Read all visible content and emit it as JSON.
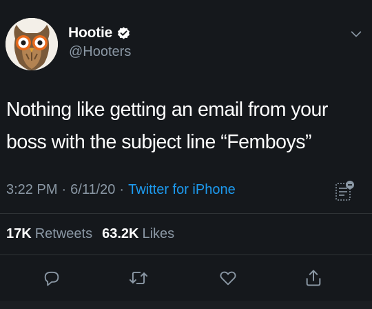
{
  "author": {
    "display_name": "Hootie",
    "handle": "@Hooters",
    "verified": true,
    "avatar_icon": "owl-logo-icon"
  },
  "tweet": {
    "text_line1": "Nothing like getting an email from your",
    "text_line2": "boss with the subject line “Femboys”",
    "time": "3:22 PM",
    "date": "6/11/20",
    "separator": "·",
    "source": "Twitter for iPhone"
  },
  "stats": {
    "retweets_count": "17K",
    "retweets_label": "Retweets",
    "likes_count": "63.2K",
    "likes_label": "Likes"
  },
  "actions": [
    "reply-icon",
    "retweet-icon",
    "like-icon",
    "share-icon"
  ],
  "colors": {
    "background": "#15181c",
    "text": "#ffffff",
    "secondary_text": "#8b98a5",
    "accent": "#1d9bf0",
    "verified_badge": "#ffffff",
    "divider": "#2f3336"
  }
}
